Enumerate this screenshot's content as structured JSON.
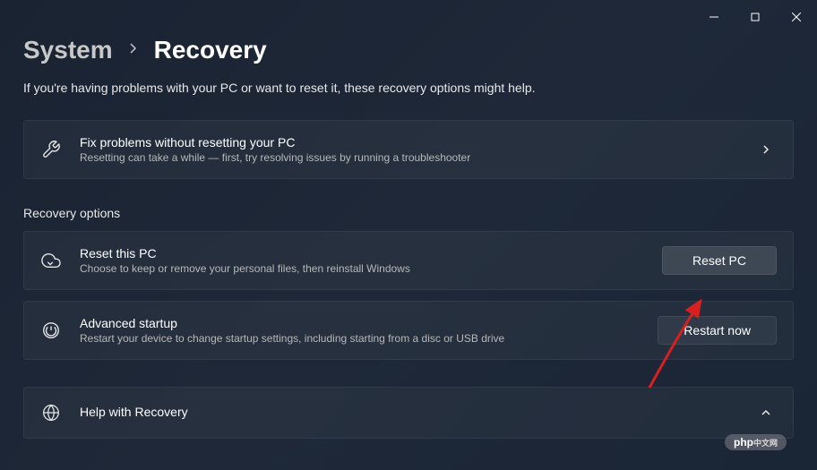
{
  "breadcrumb": {
    "parent": "System",
    "current": "Recovery"
  },
  "subtitle": "If you're having problems with your PC or want to reset it, these recovery options might help.",
  "fix_problems": {
    "title": "Fix problems without resetting your PC",
    "desc": "Resetting can take a while — first, try resolving issues by running a troubleshooter"
  },
  "section_header": "Recovery options",
  "reset_pc": {
    "title": "Reset this PC",
    "desc": "Choose to keep or remove your personal files, then reinstall Windows",
    "button": "Reset PC"
  },
  "advanced_startup": {
    "title": "Advanced startup",
    "desc": "Restart your device to change startup settings, including starting from a disc or USB drive",
    "button": "Restart now"
  },
  "help": {
    "title": "Help with Recovery"
  },
  "badge": {
    "main": "php",
    "sub": "中文网"
  }
}
